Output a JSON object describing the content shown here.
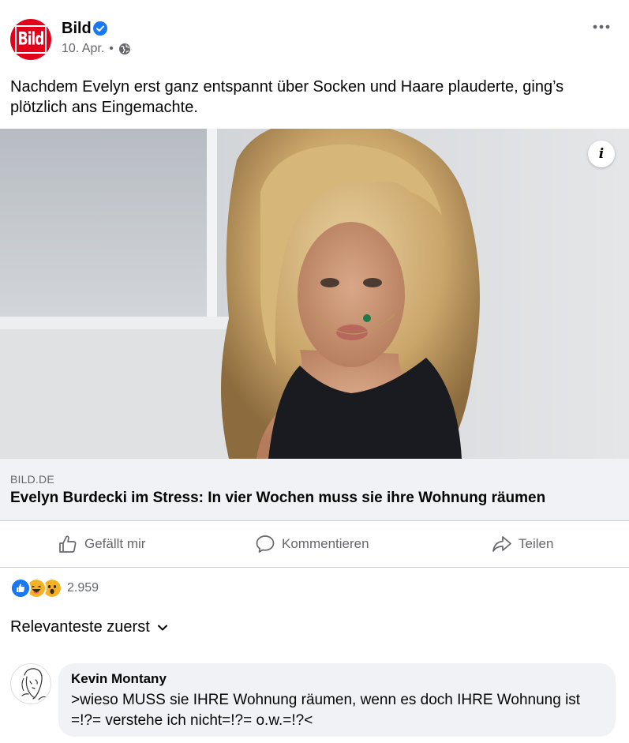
{
  "post": {
    "page_name": "Bild",
    "logo_text": "Bild",
    "date": "10. Apr.",
    "separator": "•",
    "text": "Nachdem Evelyn erst ganz entspannt über Socken und Haare plauderte, ging’s plötzlich ans Eingemachte."
  },
  "link_preview": {
    "domain": "BILD.DE",
    "title": "Evelyn Burdecki im Stress: In vier Wochen muss sie ihre Wohnung räumen",
    "info_label": "i"
  },
  "actions": {
    "like": "Gefällt mir",
    "comment": "Kommentieren",
    "share": "Teilen"
  },
  "reactions": {
    "count": "2.959",
    "types": [
      "like-icon",
      "haha-icon",
      "wow-icon"
    ]
  },
  "sort": {
    "label": "Relevanteste zuerst"
  },
  "comment": {
    "author": "Kevin Montany",
    "text": ">wieso MUSS sie IHRE Wohnung räumen, wenn es doch IHRE Wohnung ist =!?= verstehe ich nicht=!?= o.w.=!?<"
  },
  "colors": {
    "brand_red": "#e2001a",
    "verified_blue": "#1877f2",
    "muted_text": "#65676b",
    "bubble_bg": "#f0f2f5"
  }
}
